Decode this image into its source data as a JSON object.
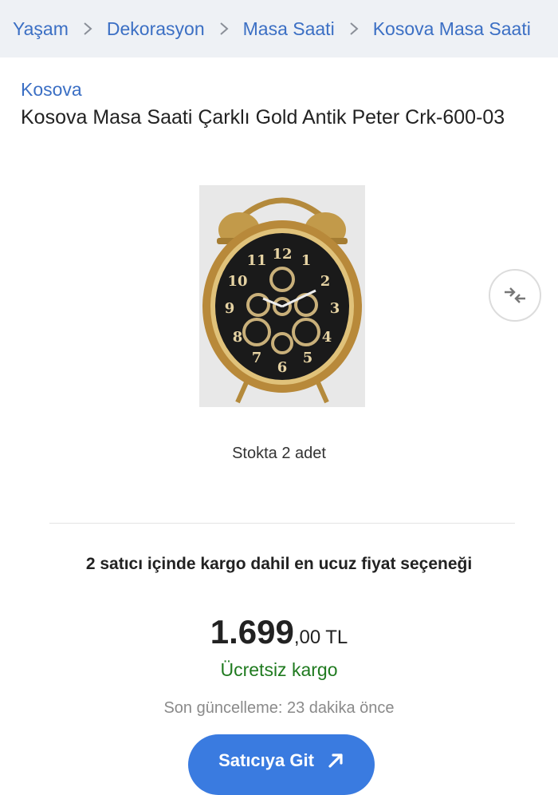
{
  "breadcrumb": {
    "items": [
      "Yaşam",
      "Dekorasyon",
      "Masa Saati",
      "Kosova Masa Saati"
    ]
  },
  "product": {
    "brand": "Kosova",
    "title": "Kosova Masa Saati Çarklı Gold Antik Peter Crk-600-03",
    "image_icon": "alarm-clock-image",
    "stock": "Stokta 2 adet"
  },
  "offer": {
    "headline": "2 satıcı içinde kargo dahil en ucuz fiyat seçeneği",
    "price_integer": "1.699",
    "price_decimal": ",00",
    "currency": "TL",
    "shipping": "Ücretsiz kargo",
    "last_update": "Son güncelleme: 23 dakika önce",
    "cta_label": "Satıcıya Git"
  },
  "colors": {
    "link": "#3b6fc4",
    "breadcrumb_bg": "#eef1f5",
    "shipping_green": "#1f7a1f",
    "cta_blue": "#3a7be0"
  }
}
